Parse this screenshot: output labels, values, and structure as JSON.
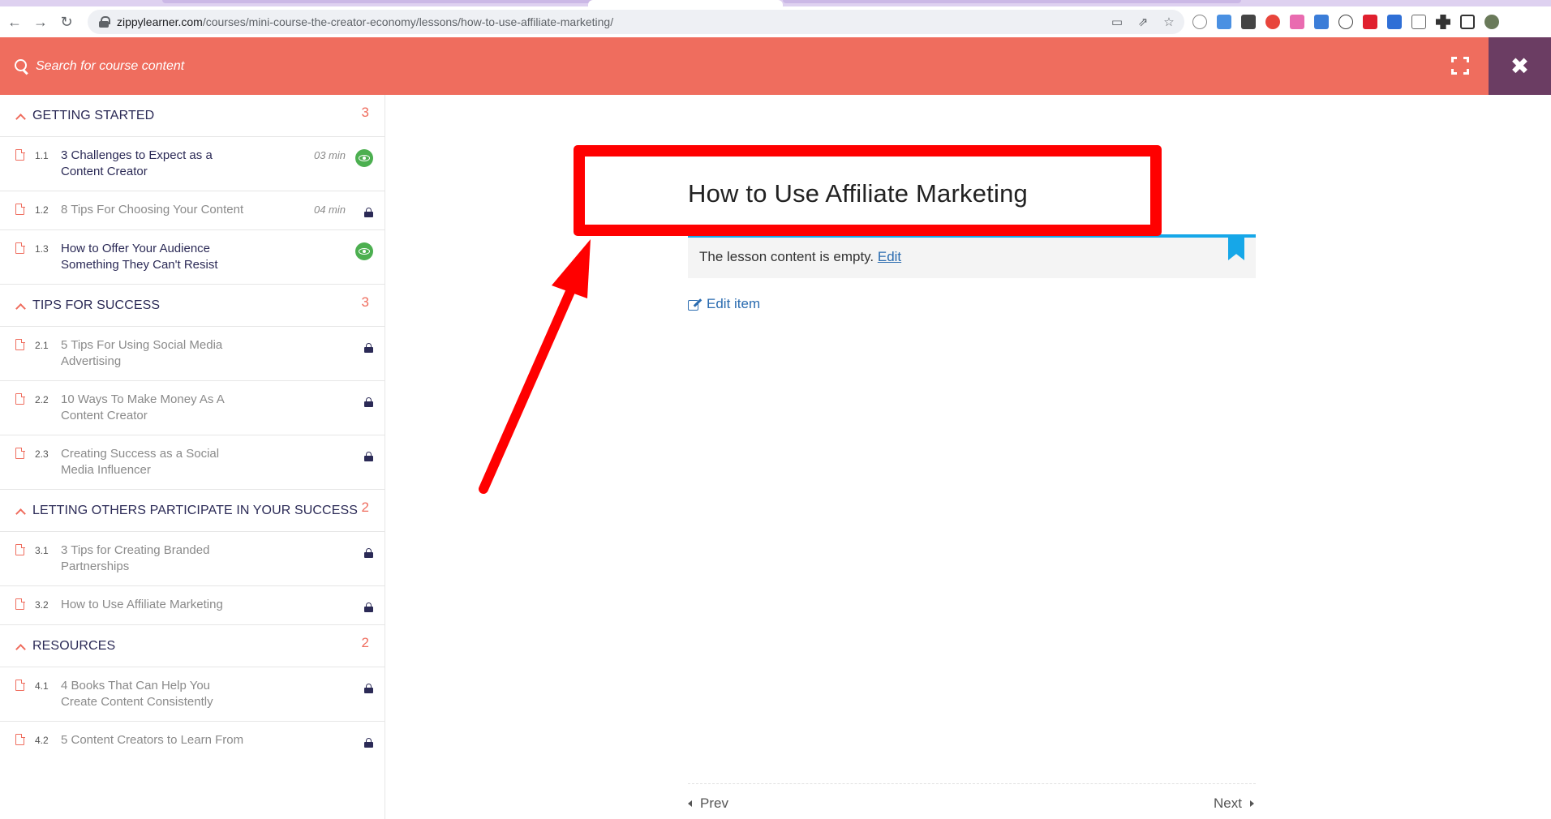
{
  "browser": {
    "url_host": "zippylearner.com",
    "url_path": "/courses/mini-course-the-creator-economy/lessons/how-to-use-affiliate-marketing/"
  },
  "header": {
    "search_placeholder": "Search for course content"
  },
  "sidebar": {
    "sections": [
      {
        "title": "GETTING STARTED",
        "count": "3",
        "lessons": [
          {
            "num": "1.1",
            "title": "3 Challenges to Expect as a Content Creator",
            "duration": "03 min",
            "status": "preview"
          },
          {
            "num": "1.2",
            "title": "8 Tips For Choosing Your Content",
            "duration": "04 min",
            "status": "locked"
          },
          {
            "num": "1.3",
            "title": "How to Offer Your Audience Something They Can't Resist",
            "duration": "",
            "status": "preview"
          }
        ]
      },
      {
        "title": "TIPS FOR SUCCESS",
        "count": "3",
        "lessons": [
          {
            "num": "2.1",
            "title": "5 Tips For Using Social Media Advertising",
            "duration": "",
            "status": "locked"
          },
          {
            "num": "2.2",
            "title": "10 Ways To Make Money As A Content Creator",
            "duration": "",
            "status": "locked"
          },
          {
            "num": "2.3",
            "title": "Creating Success as a Social Media Influencer",
            "duration": "",
            "status": "locked"
          }
        ]
      },
      {
        "title": "LETTING OTHERS PARTICIPATE IN YOUR SUCCESS",
        "count": "2",
        "lessons": [
          {
            "num": "3.1",
            "title": "3 Tips for Creating Branded Partnerships",
            "duration": "",
            "status": "locked"
          },
          {
            "num": "3.2",
            "title": "How to Use Affiliate Marketing",
            "duration": "",
            "status": "locked"
          }
        ]
      },
      {
        "title": "RESOURCES",
        "count": "2",
        "lessons": [
          {
            "num": "4.1",
            "title": "4 Books That Can Help You Create Content Consistently",
            "duration": "",
            "status": "locked"
          },
          {
            "num": "4.2",
            "title": "5 Content Creators to Learn From",
            "duration": "",
            "status": "locked"
          }
        ]
      }
    ]
  },
  "main": {
    "lesson_title": "How to Use Affiliate Marketing",
    "empty_message": "The lesson content is empty.",
    "edit_link": "Edit",
    "edit_item": "Edit item",
    "prev": "Prev",
    "next": "Next"
  },
  "colors": {
    "header": "#ef6d5e",
    "close_bg": "#6b3d63",
    "accent_blue": "#16a7e8",
    "annotation_red": "#ff0000",
    "preview_green": "#4caf50"
  }
}
